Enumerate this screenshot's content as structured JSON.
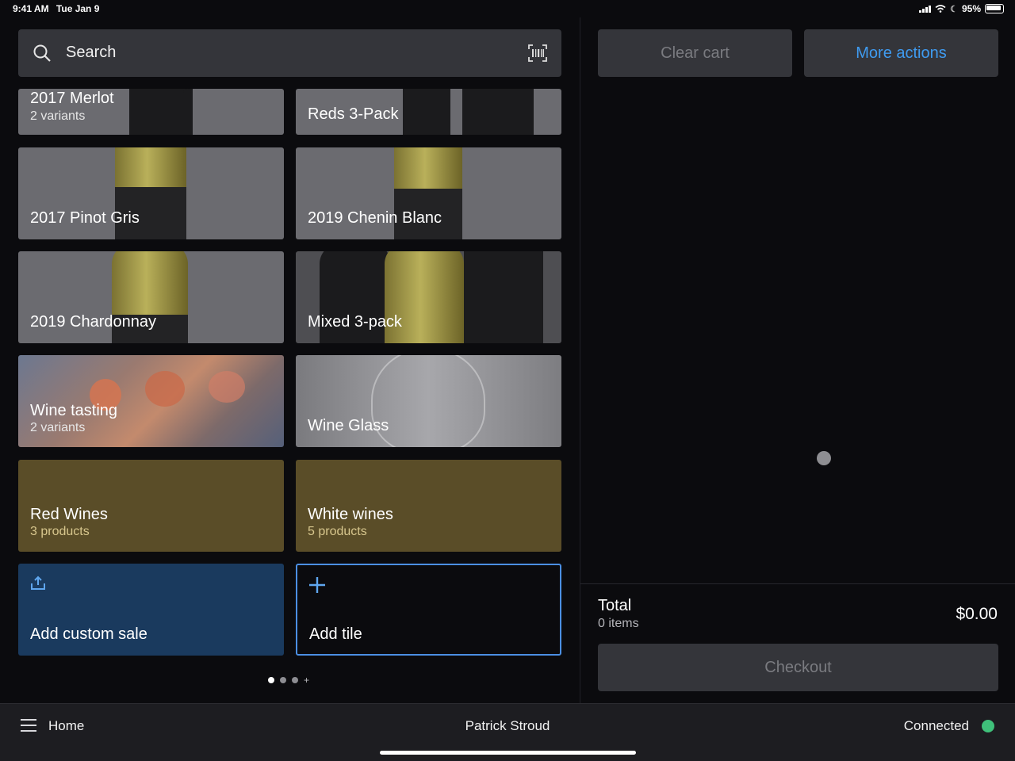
{
  "status_bar": {
    "time": "9:41 AM",
    "date": "Tue Jan 9",
    "battery": "95%"
  },
  "search": {
    "label": "Search"
  },
  "tiles": [
    {
      "label": "2017 Merlot",
      "sub": "2 variants"
    },
    {
      "label": "Reds 3-Pack",
      "sub": ""
    },
    {
      "label": "2017 Pinot Gris",
      "sub": ""
    },
    {
      "label": "2019 Chenin Blanc",
      "sub": ""
    },
    {
      "label": "2019 Chardonnay",
      "sub": ""
    },
    {
      "label": "Mixed 3-pack",
      "sub": ""
    },
    {
      "label": "Wine tasting",
      "sub": "2 variants"
    },
    {
      "label": "Wine Glass",
      "sub": ""
    },
    {
      "label": "Red Wines",
      "sub": "3 products"
    },
    {
      "label": "White wines",
      "sub": "5 products"
    },
    {
      "label": "Add custom sale",
      "sub": ""
    },
    {
      "label": "Add tile",
      "sub": ""
    }
  ],
  "pager": {
    "pages": 3,
    "current": 1
  },
  "cart": {
    "clear_label": "Clear cart",
    "more_label": "More actions",
    "total_label": "Total",
    "items_label": "0 items",
    "total_amount": "$0.00",
    "checkout_label": "Checkout"
  },
  "bottom_bar": {
    "home_label": "Home",
    "user_name": "Patrick Stroud",
    "connection_label": "Connected"
  },
  "colors": {
    "accent": "#3f9bf0",
    "folder": "#5a4d28",
    "custom_sale": "#1a3a5e",
    "connected": "#3fc07a"
  }
}
